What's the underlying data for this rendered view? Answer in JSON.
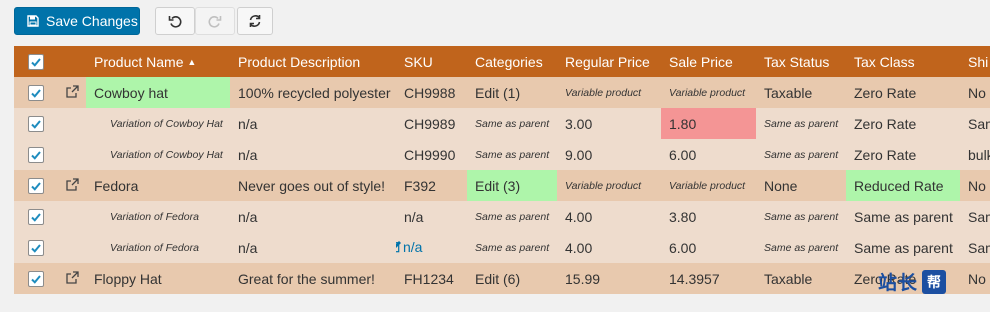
{
  "toolbar": {
    "save_label": "Save Changes",
    "undo_icon": "undo-icon",
    "redo_icon": "redo-icon",
    "refresh_icon": "refresh-icon"
  },
  "colors": {
    "header": "#c0641c",
    "parent_row": "#e8c9ae",
    "child_row": "#eedccd",
    "highlight_green": "#aef5aa",
    "highlight_red": "#f49595",
    "primary_button": "#0073aa"
  },
  "table": {
    "headers": [
      "Product Name",
      "Product Description",
      "SKU",
      "Categories",
      "Regular Price",
      "Sale Price",
      "Tax Status",
      "Tax Class",
      "Shi"
    ],
    "sort_indicator": "▲",
    "rows": [
      {
        "name": "Cowboy hat",
        "desc": "100% recycled polyester",
        "sku": "CH9988",
        "cat": "Edit (1)",
        "reg": "Variable product",
        "sale": "Variable product",
        "tax_status": "Taxable",
        "tax_class": "Zero Rate",
        "ship": "No s"
      },
      {
        "name": "Variation of Cowboy Hat",
        "desc": "n/a",
        "sku": "CH9989",
        "cat": "Same as parent",
        "reg": "3.00",
        "sale": "1.80",
        "tax_status": "Same as parent",
        "tax_class": "Zero Rate",
        "ship": "Sam"
      },
      {
        "name": "Variation of Cowboy Hat",
        "desc": "n/a",
        "sku": "CH9990",
        "cat": "Same as parent",
        "reg": "9.00",
        "sale": "6.00",
        "tax_status": "Same as parent",
        "tax_class": "Zero Rate",
        "ship": "bulk"
      },
      {
        "name": "Fedora",
        "desc": "Never goes out of style!",
        "sku": "F392",
        "cat": "Edit (3)",
        "reg": "Variable product",
        "sale": "Variable product",
        "tax_status": "None",
        "tax_class": "Reduced Rate",
        "ship": "No s"
      },
      {
        "name": "Variation of Fedora",
        "desc": "n/a",
        "sku": "n/a",
        "cat": "Same as parent",
        "reg": "4.00",
        "sale": "3.80",
        "tax_status": "Same as parent",
        "tax_class": "Same as parent",
        "ship": "Sam"
      },
      {
        "name": "Variation of Fedora",
        "desc": "n/a",
        "sku": "n/a",
        "cat": "Same as parent",
        "reg": "4.00",
        "sale": "6.00",
        "tax_status": "Same as parent",
        "tax_class": "Same as parent",
        "ship": "Sam"
      },
      {
        "name": "Floppy Hat",
        "desc": "Great for the summer!",
        "sku": "FH1234",
        "cat": "Edit (6)",
        "reg": "15.99",
        "sale": "14.3957",
        "tax_status": "Taxable",
        "tax_class": "Zero Rate",
        "ship": "No s"
      }
    ]
  },
  "watermark": {
    "text": "站长",
    "box": "帮"
  }
}
